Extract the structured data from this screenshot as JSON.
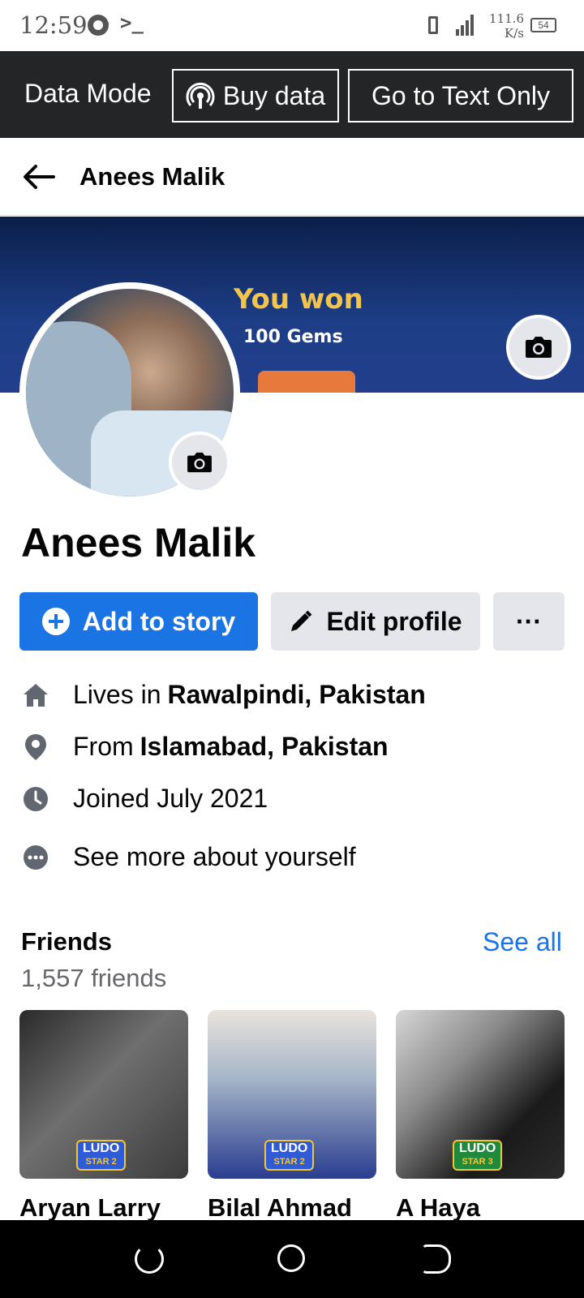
{
  "status_bar": {
    "time": "12:59",
    "terminal": ">_",
    "speed": "111.6",
    "speed_unit": "K/s",
    "battery": "54"
  },
  "data_mode": {
    "label": "Data Mode",
    "buy_data": "Buy data",
    "text_only": "Go to Text Only"
  },
  "header": {
    "title": "Anees Malik"
  },
  "cover": {
    "line1": "You won",
    "line2": "100 Gems"
  },
  "profile": {
    "name": "Anees Malik"
  },
  "actions": {
    "add_story": "Add to story",
    "edit_profile": "Edit profile",
    "more": "···"
  },
  "intro": {
    "lives_prefix": "Lives in",
    "lives_value": "Rawalpindi, Pakistan",
    "from_prefix": "From",
    "from_value": "Islamabad, Pakistan",
    "joined": "Joined July 2021",
    "see_more": "See more about yourself"
  },
  "friends": {
    "title": "Friends",
    "see_all": "See all",
    "count": "1,557 friends",
    "items": [
      {
        "name": "Aryan Larry",
        "badge": "LUDO",
        "badge_sub": "STAR 2"
      },
      {
        "name": "Bilal Ahmad",
        "badge": "LUDO",
        "badge_sub": "STAR 2"
      },
      {
        "name": "A Haya",
        "badge": "LUDO",
        "badge_sub": "STAR 3"
      }
    ]
  },
  "colors": {
    "accent": "#1b74e4",
    "dark_bar": "#242526",
    "secondary_button": "#e4e6eb",
    "muted_text": "#65676b"
  },
  "icons": {
    "whatsapp": "whatsapp-icon",
    "signal": "signal-icon",
    "back": "back-arrow-icon",
    "camera": "camera-icon",
    "pencil": "pencil-icon",
    "home": "home-icon",
    "location": "location-pin-icon",
    "clock": "clock-icon",
    "more": "more-dots-icon"
  }
}
